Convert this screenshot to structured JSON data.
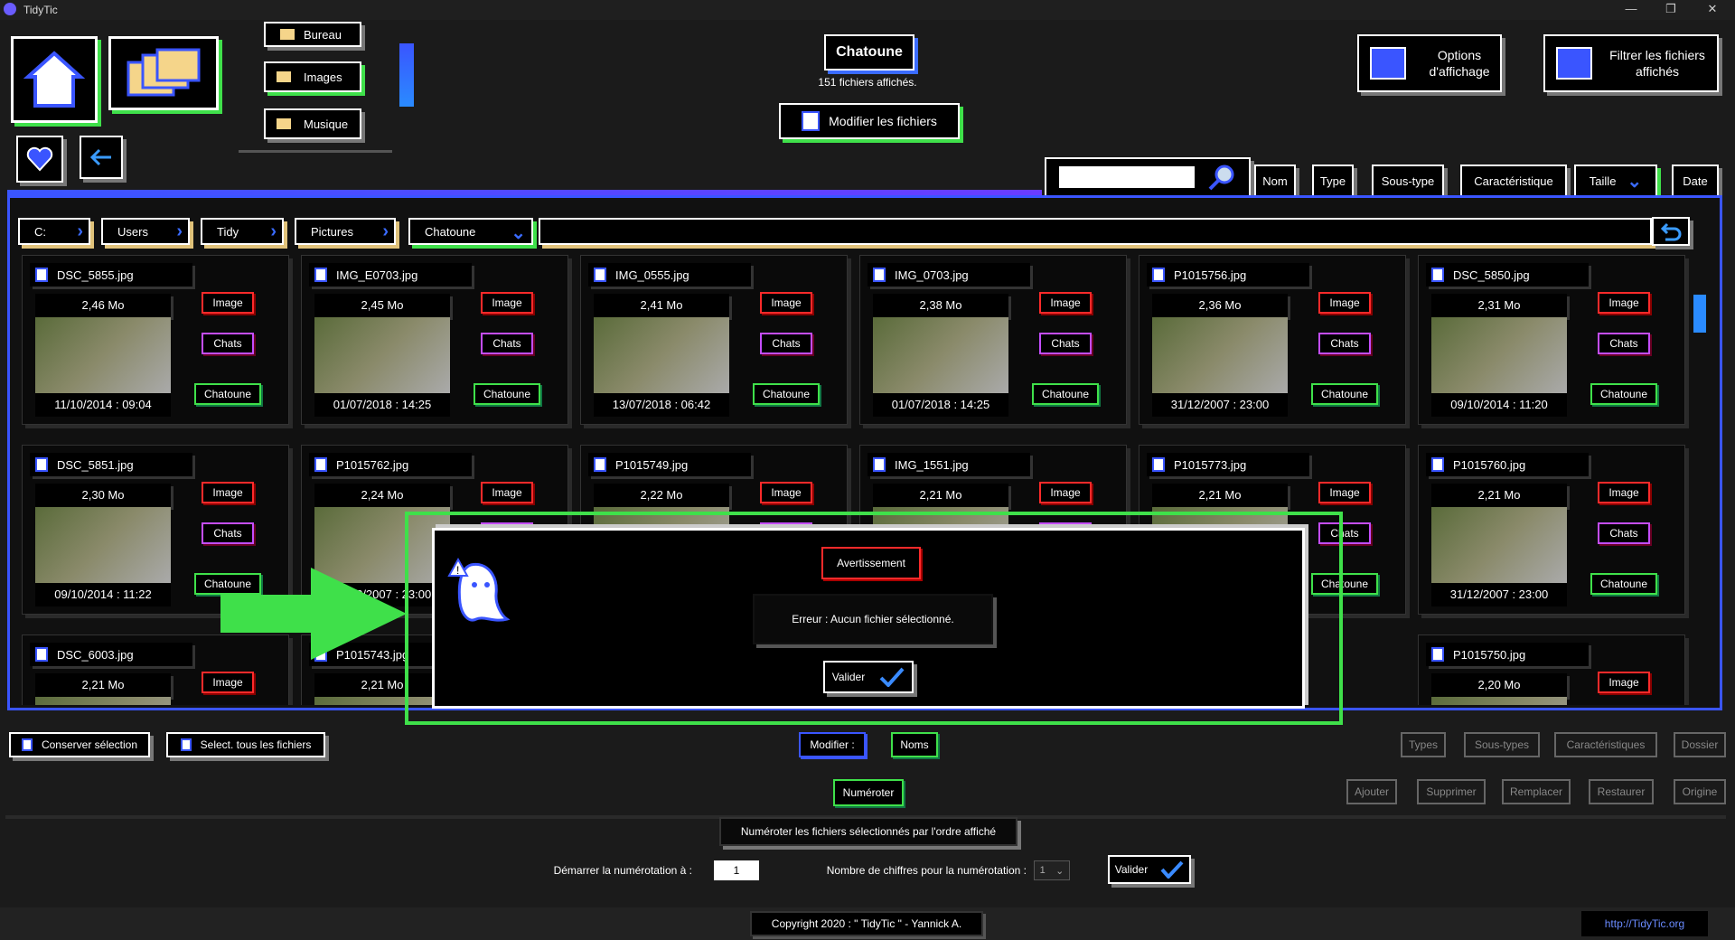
{
  "window": {
    "title": "TidyTic",
    "controls": [
      "—",
      "❐",
      "✕"
    ]
  },
  "nav": {
    "home_icon": "home-icon",
    "folders_icon": "folders-icon",
    "favorite_icon": "heart-icon",
    "back_icon": "back-arrow-icon"
  },
  "shortcuts": {
    "items": [
      {
        "label": "Bureau"
      },
      {
        "label": "Images"
      },
      {
        "label": "Musique"
      }
    ]
  },
  "header": {
    "folder_name": "Chatoune",
    "files_shown": "151 fichiers affichés.",
    "modify_files": "Modifier les fichiers"
  },
  "options": {
    "display_options": "Options d'affichage",
    "filter_files": "Filtrer les fichiers affichés"
  },
  "search": {
    "value": ""
  },
  "sort": {
    "nom": "Nom",
    "type": "Type",
    "sous_type": "Sous-type",
    "caracteristique": "Caractéristique",
    "taille": "Taille",
    "date": "Date"
  },
  "breadcrumb": [
    "C:",
    "Users",
    "Tidy",
    "Pictures",
    "Chatoune"
  ],
  "tags": {
    "image": "Image",
    "chats": "Chats",
    "chatoune": "Chatoune"
  },
  "files": [
    {
      "name": "DSC_5855.jpg",
      "size": "2,46 Mo",
      "date": "11/10/2014 : 09:04"
    },
    {
      "name": "IMG_E0703.jpg",
      "size": "2,45 Mo",
      "date": "01/07/2018 : 14:25"
    },
    {
      "name": "IMG_0555.jpg",
      "size": "2,41 Mo",
      "date": "13/07/2018 : 06:42"
    },
    {
      "name": "IMG_0703.jpg",
      "size": "2,38 Mo",
      "date": "01/07/2018 : 14:25"
    },
    {
      "name": "P1015756.jpg",
      "size": "2,36 Mo",
      "date": "31/12/2007 : 23:00"
    },
    {
      "name": "DSC_5850.jpg",
      "size": "2,31 Mo",
      "date": "09/10/2014 : 11:20"
    },
    {
      "name": "DSC_5851.jpg",
      "size": "2,30 Mo",
      "date": "09/10/2014 : 11:22"
    },
    {
      "name": "P1015762.jpg",
      "size": "2,24 Mo",
      "date": "31/12/2007 : 23:00"
    },
    {
      "name": "P1015749.jpg",
      "size": "2,22 Mo",
      "date": ""
    },
    {
      "name": "IMG_1551.jpg",
      "size": "2,21 Mo",
      "date": ""
    },
    {
      "name": "P1015773.jpg",
      "size": "2,21 Mo",
      "date": ""
    },
    {
      "name": "P1015760.jpg",
      "size": "2,21 Mo",
      "date": "31/12/2007 : 23:00"
    },
    {
      "name": "DSC_6003.jpg",
      "size": "2,21 Mo",
      "date": ""
    },
    {
      "name": "P1015743.jpg",
      "size": "2,21 Mo",
      "date": ""
    },
    {
      "name": "P1015750.jpg",
      "size": "2,20 Mo",
      "date": ""
    }
  ],
  "dialog": {
    "title": "Avertissement",
    "message": "Erreur : Aucun fichier sélectionné.",
    "ok": "Valider",
    "ghost_icon": "ghost-warning-icon"
  },
  "bottom": {
    "keep_selection": "Conserver sélection",
    "select_all": "Select. tous les fichiers",
    "modify": "Modifier :",
    "names": "Noms",
    "types": "Types",
    "subtypes": "Sous-types",
    "characteristics": "Caractéristiques",
    "folder": "Dossier",
    "number": "Numéroter",
    "add": "Ajouter",
    "delete": "Supprimer",
    "replace": "Remplacer",
    "restore": "Restaurer",
    "origin": "Origine",
    "numbering_title": "Numéroter les fichiers sélectionnés par l'ordre affiché",
    "start_label": "Démarrer la numérotation à :",
    "start_value": "1",
    "digits_label": "Nombre de chiffres pour la numérotation :",
    "digits_value": "1",
    "validate": "Valider"
  },
  "footer": {
    "copyright": "Copyright 2020 : \" TidyTic \" - Yannick A.",
    "url": "http://TidyTic.org"
  },
  "colors": {
    "accent_blue": "#3a55ff",
    "accent_green": "#3fe04a",
    "warning_red": "#ff2a2a"
  }
}
